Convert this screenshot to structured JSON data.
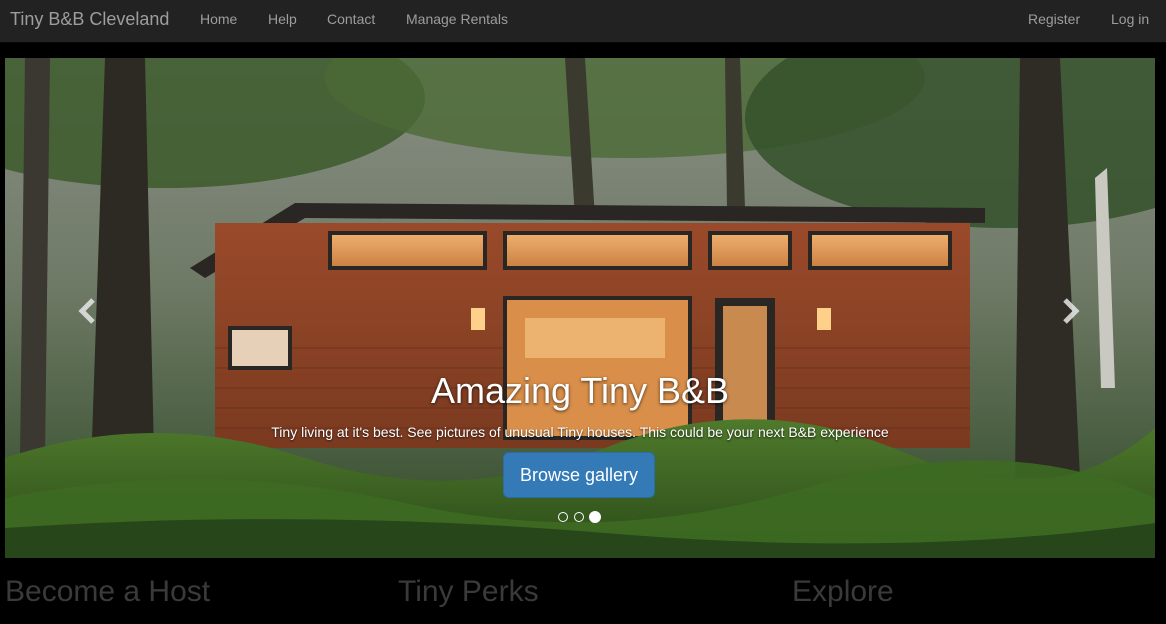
{
  "navbar": {
    "brand": "Tiny B&B Cleveland",
    "links": [
      "Home",
      "Help",
      "Contact",
      "Manage Rentals"
    ],
    "right_links": [
      "Register",
      "Log in"
    ]
  },
  "carousel": {
    "title": "Amazing Tiny B&B",
    "text": "Tiny living at it's best. See pictures of unusual Tiny houses. This could be your next B&B experience",
    "button": "Browse gallery",
    "slide_count": 3,
    "active_slide": 3,
    "prev_icon": "chevron-left-icon",
    "next_icon": "chevron-right-icon"
  },
  "sections": [
    "Become a Host",
    "Tiny Perks",
    "Explore"
  ],
  "colors": {
    "navbar_bg": "#222222",
    "nav_text": "#9d9d9d",
    "button_bg": "#337ab7",
    "section_heading": "#3a3a3a"
  }
}
